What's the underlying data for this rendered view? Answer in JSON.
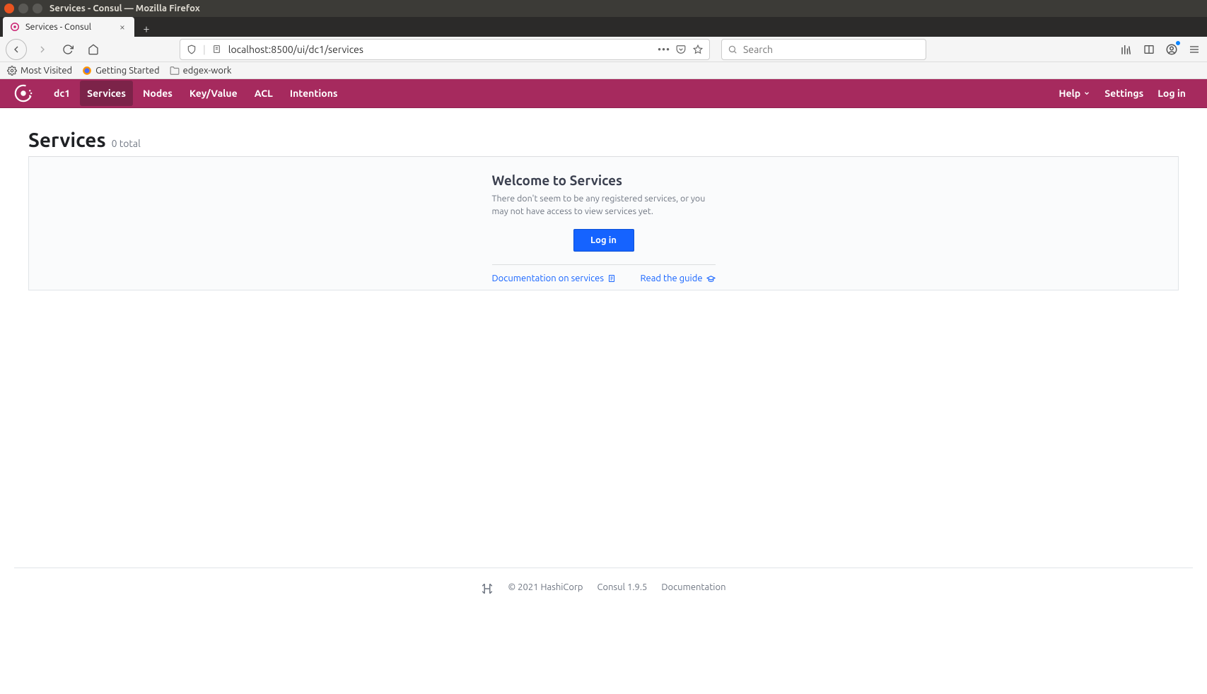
{
  "window": {
    "title": "Services - Consul — Mozilla Firefox"
  },
  "tab": {
    "title": "Services - Consul"
  },
  "browser": {
    "url": "localhost:8500/ui/dc1/services",
    "search_placeholder": "Search"
  },
  "bookmarks": {
    "most_visited": "Most Visited",
    "getting_started": "Getting Started",
    "edgex_work": "edgex-work"
  },
  "nav": {
    "dc": "dc1",
    "services": "Services",
    "nodes": "Nodes",
    "kv": "Key/Value",
    "acl": "ACL",
    "intentions": "Intentions",
    "help": "Help",
    "settings": "Settings",
    "login": "Log in"
  },
  "page": {
    "title": "Services",
    "count": "0 total"
  },
  "empty": {
    "heading": "Welcome to Services",
    "body": "There don't seem to be any registered services, or you may not have access to view services yet.",
    "login": "Log in",
    "docs": "Documentation on services",
    "guide": "Read the guide"
  },
  "footer": {
    "copyright": "© 2021 HashiCorp",
    "version": "Consul 1.9.5",
    "docs": "Documentation"
  }
}
